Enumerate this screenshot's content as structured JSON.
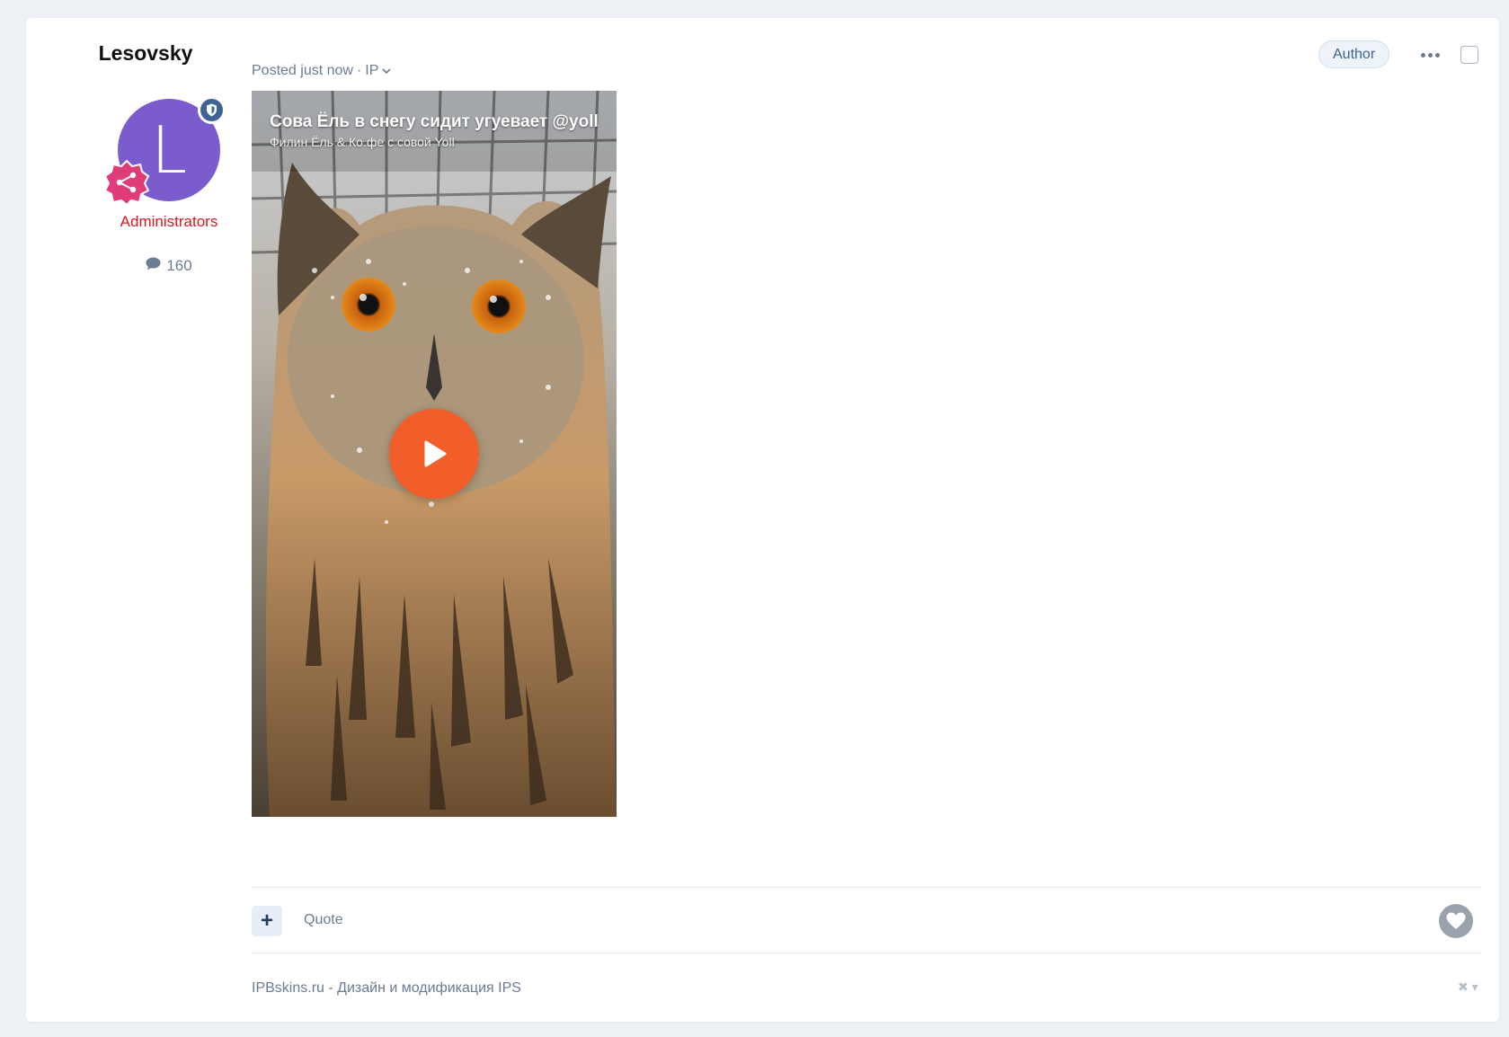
{
  "author": {
    "name": "Lesovsky",
    "avatar_letter": "L",
    "avatar_color": "#7a5ccc",
    "group": "Administrators",
    "group_color": "#e0141e",
    "post_count": "160",
    "moderator_icon": "shield-icon",
    "reputation_icon": "share-badge-icon"
  },
  "post": {
    "meta_posted": "Posted just now",
    "meta_separator": "·",
    "meta_ip": "IP",
    "author_badge": "Author"
  },
  "video": {
    "title": "Сова Ёль в снегу сидит угуевает @yoll",
    "subtitle": "Филин Ёль & Ко.фе с совой Yoll",
    "play_color": "#f25e2a"
  },
  "footer": {
    "add_label": "+",
    "quote_label": "Quote",
    "signature": "IPBskins.ru - Дизайн и модификация IPS"
  }
}
